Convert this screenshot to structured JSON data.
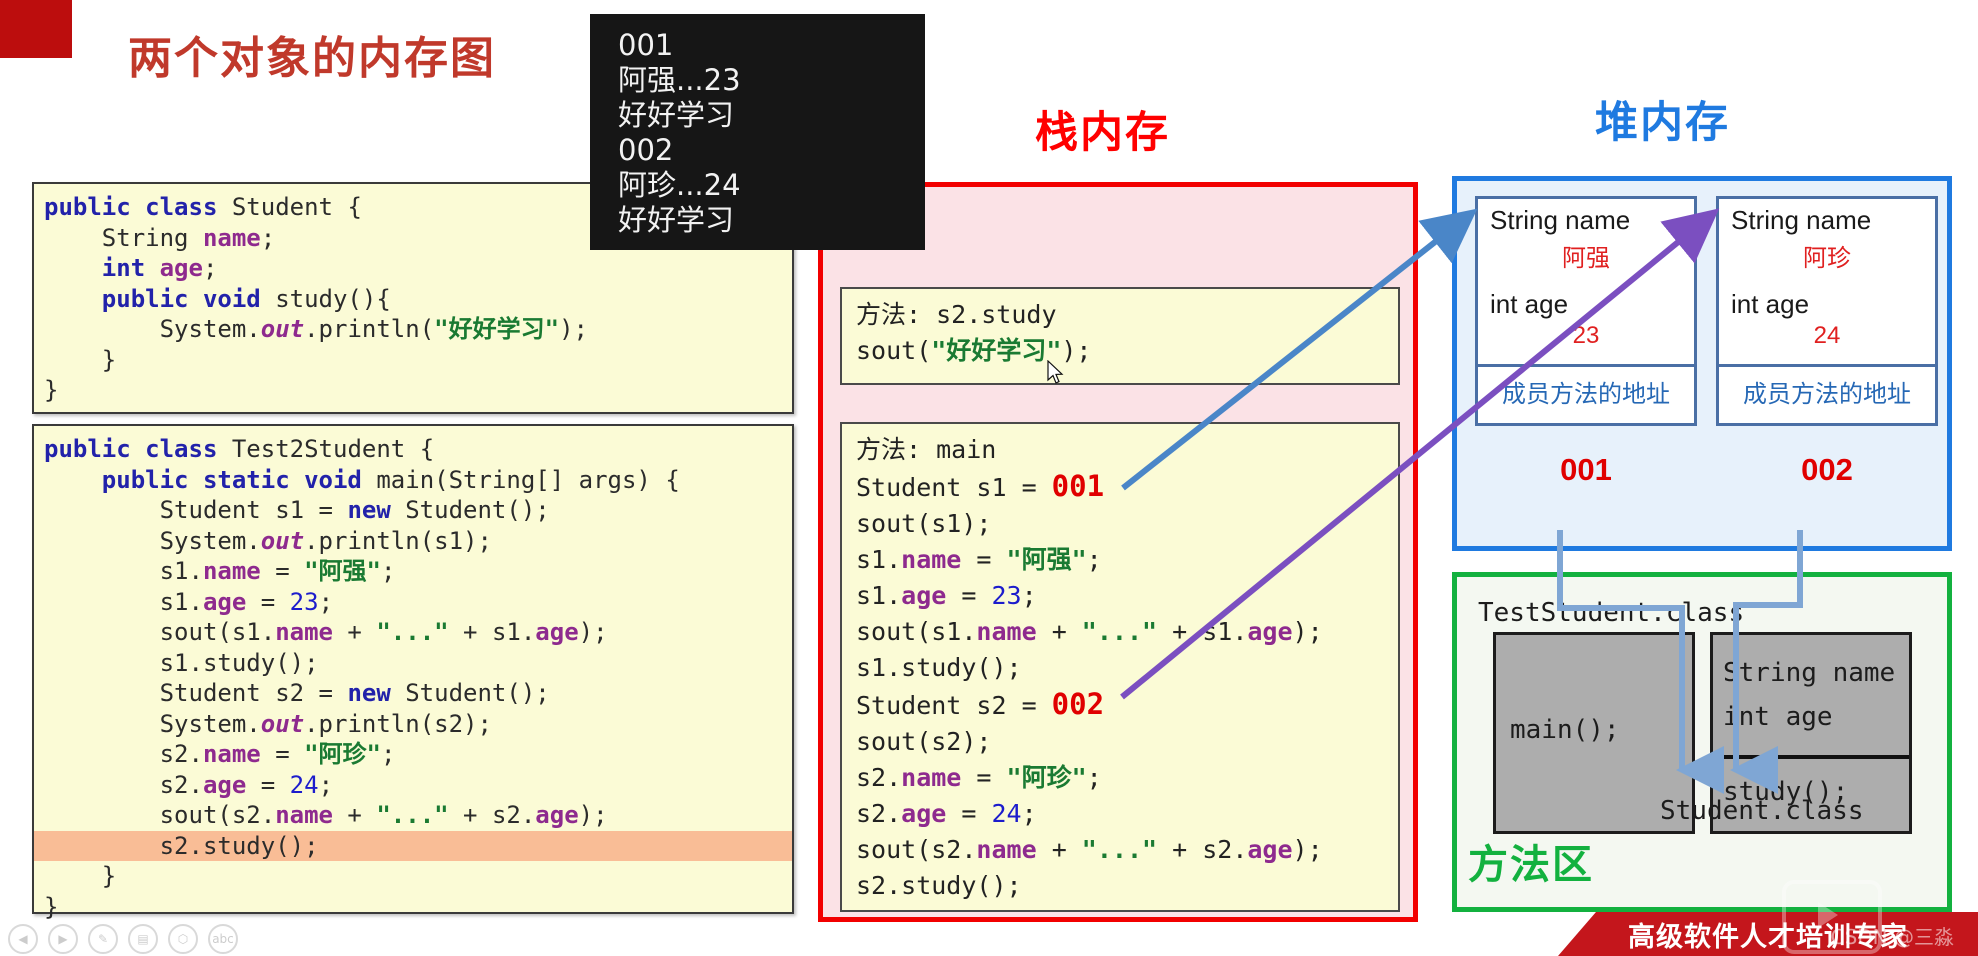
{
  "slide": {
    "title": "两个对象的内存图"
  },
  "console": {
    "lines": [
      "001",
      "阿强...23",
      "好好学习",
      "002",
      "阿珍...24",
      "好好学习"
    ]
  },
  "code_student": {
    "lines": [
      [
        {
          "t": "public ",
          "c": "kw"
        },
        {
          "t": "class ",
          "c": "kw"
        },
        {
          "t": "Student {",
          "c": ""
        }
      ],
      [
        {
          "t": "    String ",
          "c": ""
        },
        {
          "t": "name",
          "c": "fld"
        },
        {
          "t": ";",
          "c": ""
        }
      ],
      [
        {
          "t": "    ",
          "c": ""
        },
        {
          "t": "int ",
          "c": "kw"
        },
        {
          "t": "age",
          "c": "fld"
        },
        {
          "t": ";",
          "c": ""
        }
      ],
      [
        {
          "t": "    ",
          "c": ""
        },
        {
          "t": "public void ",
          "c": "kw"
        },
        {
          "t": "study(){",
          "c": ""
        }
      ],
      [
        {
          "t": "        System.",
          "c": ""
        },
        {
          "t": "out",
          "c": "it"
        },
        {
          "t": ".println(",
          "c": ""
        },
        {
          "t": "\"好好学习\"",
          "c": "str"
        },
        {
          "t": ");",
          "c": ""
        }
      ],
      [
        {
          "t": "    }",
          "c": ""
        }
      ],
      [
        {
          "t": "}",
          "c": ""
        }
      ]
    ]
  },
  "code_test": {
    "lines": [
      [
        {
          "t": "public ",
          "c": "kw"
        },
        {
          "t": "class ",
          "c": "kw"
        },
        {
          "t": "Test2Student {",
          "c": ""
        }
      ],
      [
        {
          "t": "    ",
          "c": ""
        },
        {
          "t": "public static void ",
          "c": "kw"
        },
        {
          "t": "main(String[] args) {",
          "c": ""
        }
      ],
      [
        {
          "t": "        Student s1 = ",
          "c": ""
        },
        {
          "t": "new ",
          "c": "kw"
        },
        {
          "t": "Student();",
          "c": ""
        }
      ],
      [
        {
          "t": "        System.",
          "c": ""
        },
        {
          "t": "out",
          "c": "it"
        },
        {
          "t": ".println(s1);",
          "c": ""
        }
      ],
      [
        {
          "t": "        s1.",
          "c": ""
        },
        {
          "t": "name",
          "c": "fld"
        },
        {
          "t": " = ",
          "c": ""
        },
        {
          "t": "\"阿强\"",
          "c": "str"
        },
        {
          "t": ";",
          "c": ""
        }
      ],
      [
        {
          "t": "        s1.",
          "c": ""
        },
        {
          "t": "age",
          "c": "fld"
        },
        {
          "t": " = ",
          "c": ""
        },
        {
          "t": "23",
          "c": "num"
        },
        {
          "t": ";",
          "c": ""
        }
      ],
      [
        {
          "t": "        sout(s1.",
          "c": ""
        },
        {
          "t": "name",
          "c": "fld"
        },
        {
          "t": " + ",
          "c": ""
        },
        {
          "t": "\"...\"",
          "c": "str"
        },
        {
          "t": " + s1.",
          "c": ""
        },
        {
          "t": "age",
          "c": "fld"
        },
        {
          "t": ");",
          "c": ""
        }
      ],
      [
        {
          "t": "        s1.study();",
          "c": ""
        }
      ],
      [
        {
          "t": "        Student s2 = ",
          "c": ""
        },
        {
          "t": "new ",
          "c": "kw"
        },
        {
          "t": "Student();",
          "c": ""
        }
      ],
      [
        {
          "t": "        System.",
          "c": ""
        },
        {
          "t": "out",
          "c": "it"
        },
        {
          "t": ".println(s2);",
          "c": ""
        }
      ],
      [
        {
          "t": "        s2.",
          "c": ""
        },
        {
          "t": "name",
          "c": "fld"
        },
        {
          "t": " = ",
          "c": ""
        },
        {
          "t": "\"阿珍\"",
          "c": "str"
        },
        {
          "t": ";",
          "c": ""
        }
      ],
      [
        {
          "t": "        s2.",
          "c": ""
        },
        {
          "t": "age",
          "c": "fld"
        },
        {
          "t": " = ",
          "c": ""
        },
        {
          "t": "24",
          "c": "num"
        },
        {
          "t": ";",
          "c": ""
        }
      ],
      [
        {
          "t": "        sout(s2.",
          "c": ""
        },
        {
          "t": "name",
          "c": "fld"
        },
        {
          "t": " + ",
          "c": ""
        },
        {
          "t": "\"...\"",
          "c": "str"
        },
        {
          "t": " + s2.",
          "c": ""
        },
        {
          "t": "age",
          "c": "fld"
        },
        {
          "t": ");",
          "c": ""
        }
      ],
      [
        {
          "t": "        s2.study();",
          "c": "",
          "hl": true
        }
      ],
      [
        {
          "t": "    }",
          "c": ""
        }
      ],
      [
        {
          "t": "}",
          "c": ""
        }
      ]
    ],
    "highlight_line_index": 13
  },
  "stack": {
    "title": "栈内存",
    "color": "#ff0000",
    "frame_study": {
      "lines": [
        [
          {
            "t": "方法: s2.study",
            "c": ""
          }
        ],
        [
          {
            "t": "sout(",
            "c": ""
          },
          {
            "t": "\"好好学习\"",
            "c": "str"
          },
          {
            "t": ");",
            "c": ""
          }
        ]
      ]
    },
    "frame_main": {
      "lines": [
        [
          {
            "t": "方法: main",
            "c": ""
          }
        ],
        [
          {
            "t": "Student s1 = ",
            "c": ""
          },
          {
            "t": "001",
            "c": "addr"
          }
        ],
        [
          {
            "t": "sout(s1);",
            "c": ""
          }
        ],
        [
          {
            "t": "s1.",
            "c": ""
          },
          {
            "t": "name",
            "c": "fld"
          },
          {
            "t": " = ",
            "c": ""
          },
          {
            "t": "\"阿强\"",
            "c": "str"
          },
          {
            "t": ";",
            "c": ""
          }
        ],
        [
          {
            "t": "s1.",
            "c": ""
          },
          {
            "t": "age",
            "c": "fld"
          },
          {
            "t": " = ",
            "c": ""
          },
          {
            "t": "23",
            "c": "num"
          },
          {
            "t": ";",
            "c": ""
          }
        ],
        [
          {
            "t": "sout(s1.",
            "c": ""
          },
          {
            "t": "name",
            "c": "fld"
          },
          {
            "t": " + ",
            "c": ""
          },
          {
            "t": "\"...\"",
            "c": "str"
          },
          {
            "t": " + s1.",
            "c": ""
          },
          {
            "t": "age",
            "c": "fld"
          },
          {
            "t": ");",
            "c": ""
          }
        ],
        [
          {
            "t": "s1.study();",
            "c": ""
          }
        ],
        [
          {
            "t": "Student s2 = ",
            "c": ""
          },
          {
            "t": "002",
            "c": "addr"
          }
        ],
        [
          {
            "t": "sout(s2);",
            "c": ""
          }
        ],
        [
          {
            "t": "s2.",
            "c": ""
          },
          {
            "t": "name",
            "c": "fld"
          },
          {
            "t": " = ",
            "c": ""
          },
          {
            "t": "\"阿珍\"",
            "c": "str"
          },
          {
            "t": ";",
            "c": ""
          }
        ],
        [
          {
            "t": "s2.",
            "c": ""
          },
          {
            "t": "age",
            "c": "fld"
          },
          {
            "t": " = ",
            "c": ""
          },
          {
            "t": "24",
            "c": "num"
          },
          {
            "t": ";",
            "c": ""
          }
        ],
        [
          {
            "t": "sout(s2.",
            "c": ""
          },
          {
            "t": "name",
            "c": "fld"
          },
          {
            "t": " + ",
            "c": ""
          },
          {
            "t": "\"...\"",
            "c": "str"
          },
          {
            "t": " + s2.",
            "c": ""
          },
          {
            "t": "age",
            "c": "fld"
          },
          {
            "t": ");",
            "c": ""
          }
        ],
        [
          {
            "t": "s2.study();",
            "c": ""
          }
        ]
      ]
    }
  },
  "heap": {
    "title": "堆内存",
    "color": "#1f7ae0",
    "objects": [
      {
        "name_label": "String name",
        "name_value": "阿强",
        "age_label": "int age",
        "age_value": "23",
        "method_addr": "成员方法的地址",
        "address": "001"
      },
      {
        "name_label": "String name",
        "name_value": "阿珍",
        "age_label": "int age",
        "age_value": "24",
        "method_addr": "成员方法的地址",
        "address": "002"
      }
    ]
  },
  "method_area": {
    "label": "方法区",
    "color": "#13b13f",
    "test_class_title": "TestStudent.class",
    "test_class_body": "main();",
    "student_class_title": "Student.class",
    "student_fields": [
      "String name",
      "int age"
    ],
    "student_method": "study();"
  },
  "banner": {
    "text": "高级软件人才培训专家",
    "watermark": "CSDN @三淼"
  },
  "player_controls": [
    "◀",
    "▶",
    "✎",
    "▤",
    "⬡",
    "abc"
  ]
}
